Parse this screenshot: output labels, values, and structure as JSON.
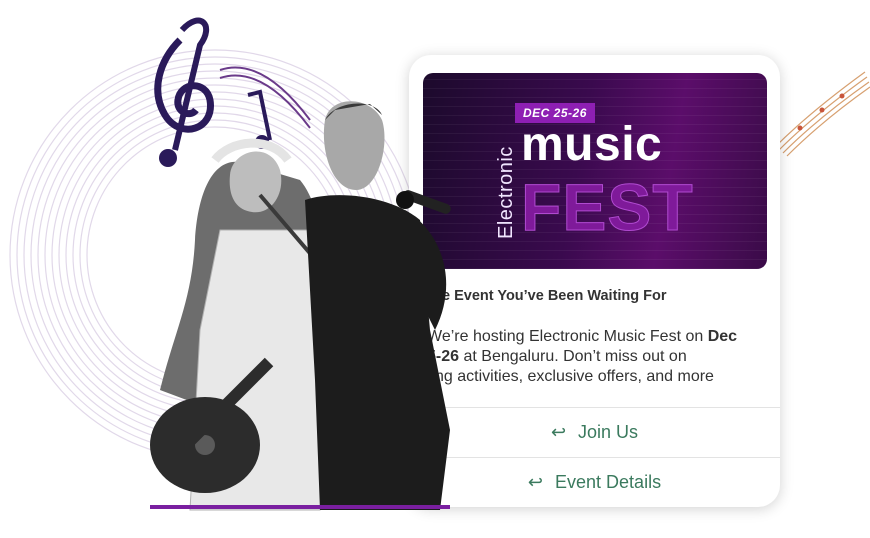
{
  "banner": {
    "date": "DEC 25-26",
    "vertical_word": "Electronic",
    "word_music": "music",
    "word_fest": "FEST"
  },
  "message": {
    "title": "e Event You’ve Been Waiting For",
    "body_line1_prefix": "We’re hosting Electronic Music Fest on ",
    "body_line1_bold": "Dec",
    "body_line2_bold": "5-26",
    "body_line2_rest": " at Bengaluru. Don’t miss out on",
    "body_line3": "ting activities, exclusive offers, and more"
  },
  "actions": {
    "join_label": "Join Us",
    "details_label": "Event Details"
  },
  "colors": {
    "accent": "#3b7a5e",
    "banner_purple": "#5b0d6a",
    "badge": "#8e1fb3"
  }
}
